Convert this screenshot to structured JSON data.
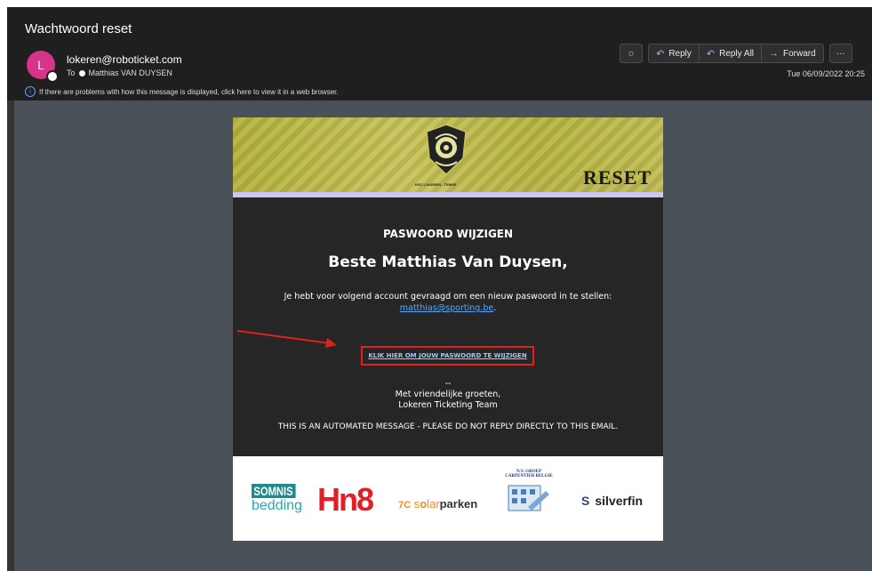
{
  "email": {
    "subject": "Wachtwoord reset",
    "avatar_letter": "L",
    "from": "lokeren@roboticket.com",
    "to_prefix": "To",
    "to_name": "Matthias VAN DUYSEN",
    "info_text": "If there are problems with how this message is displayed, click here to view it in a web browser.",
    "date": "Tue 06/09/2022 20:25"
  },
  "toolbar": {
    "theme_icon": "sun-icon",
    "reply": "Reply",
    "reply_all": "Reply All",
    "forward": "Forward",
    "more": "···"
  },
  "message": {
    "hero_word": "RESET",
    "logo_caption": "KSC LOKEREN - TEMSE",
    "heading": "PASWOORD WIJZIGEN",
    "greeting": "Beste Matthias Van Duysen,",
    "intro": "Je hebt voor volgend account gevraagd om een nieuw paswoord in te stellen:",
    "email_link": "matthias@sporting.be",
    "email_suffix": ".",
    "cta": "KLIK HIER OM JOUW PASWOORD TE WIJZIGEN",
    "dash": "--",
    "regards": "Met vriendelijke groeten,",
    "team": "Lokeren Ticketing Team",
    "automated": "THIS IS AN AUTOMATED MESSAGE - PLEASE DO NOT REPLY DIRECTLY TO THIS EMAIL."
  },
  "sponsors": {
    "somnis_top": "SOMNIS",
    "somnis_bottom": "bedding",
    "hn8": "Hn8",
    "hn8_sub": "schulsysteme",
    "solarparken_prefix": "7C",
    "solarparken_mid": " s",
    "solarparken_o": "o",
    "solarparken_lar": "lar",
    "solarparken_end": "parken",
    "carpentier_line1": "N.V. GROEP",
    "carpentier_line2": "CARPENTIER BELGIE",
    "silverfin": "silverfin",
    "silverfin_mark": "S"
  },
  "colors": {
    "accent_pink": "#d6338a",
    "cta_border": "#e12020",
    "link_blue": "#55aaff",
    "hero_yellow": "#bdb94a"
  }
}
